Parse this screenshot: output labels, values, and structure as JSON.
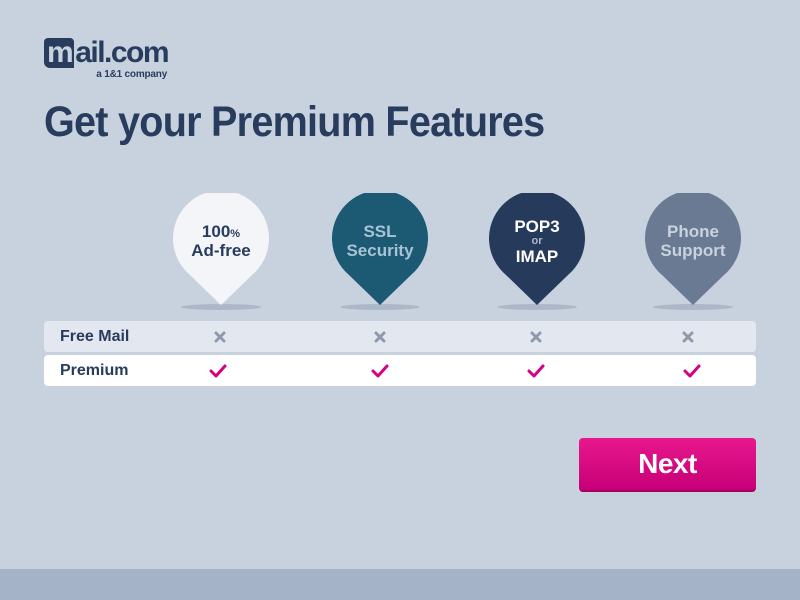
{
  "logo": {
    "main": "mail.com",
    "m": "m",
    "rest": "ail.com",
    "tagline": "a 1&1 company"
  },
  "title": "Get your Premium Features",
  "features": [
    {
      "line1": "100",
      "line1_suffix": "%",
      "line2": "Ad-free",
      "fill": "#f3f5f8",
      "text_color": "#283c5e"
    },
    {
      "line1": "SSL",
      "line2": "Security",
      "fill": "#1b5a72",
      "text_color": "#a9c3d6"
    },
    {
      "line1": "POP3",
      "middle": "or",
      "line2": "IMAP",
      "fill": "#263a5c",
      "text_color": "#ffffff"
    },
    {
      "line1": "Phone",
      "line2": "Support",
      "fill": "#6a7a93",
      "text_color": "#c9d2de"
    }
  ],
  "comparison": {
    "rows": [
      {
        "label": "Free Mail",
        "marks": [
          "cross",
          "cross",
          "cross",
          "cross"
        ]
      },
      {
        "label": "Premium",
        "marks": [
          "check",
          "check",
          "check",
          "check"
        ]
      }
    ]
  },
  "actions": {
    "next_label": "Next"
  },
  "colors": {
    "background": "#c8d2df",
    "brand_navy": "#283c5e",
    "accent_pink": "#d6007f",
    "cross_gray": "#8e99ab"
  }
}
